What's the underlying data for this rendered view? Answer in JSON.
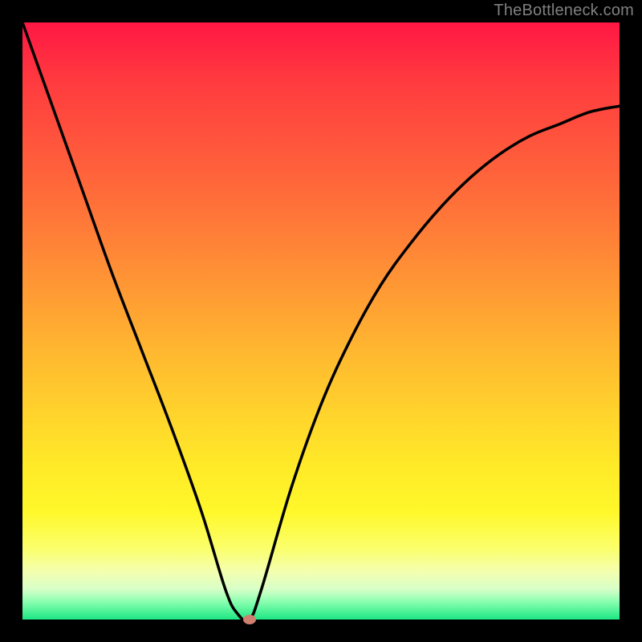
{
  "watermark": "TheBottleneck.com",
  "chart_data": {
    "type": "line",
    "title": "",
    "xlabel": "",
    "ylabel": "",
    "xlim": [
      0,
      100
    ],
    "ylim": [
      0,
      100
    ],
    "background_gradient": {
      "top": "#ff1744",
      "bottom": "#1ce783"
    },
    "series": [
      {
        "name": "bottleneck-curve",
        "x": [
          0,
          5,
          10,
          15,
          20,
          25,
          30,
          34,
          36,
          38,
          40,
          45,
          50,
          55,
          60,
          65,
          70,
          75,
          80,
          85,
          90,
          95,
          100
        ],
        "values": [
          100,
          86,
          72,
          58,
          45,
          32,
          18,
          5,
          1,
          0,
          5,
          22,
          36,
          47,
          56,
          63,
          69,
          74,
          78,
          81,
          83,
          85,
          86
        ]
      }
    ],
    "marker": {
      "name": "min-point",
      "x": 38,
      "y": 0,
      "color": "#d08070"
    }
  }
}
